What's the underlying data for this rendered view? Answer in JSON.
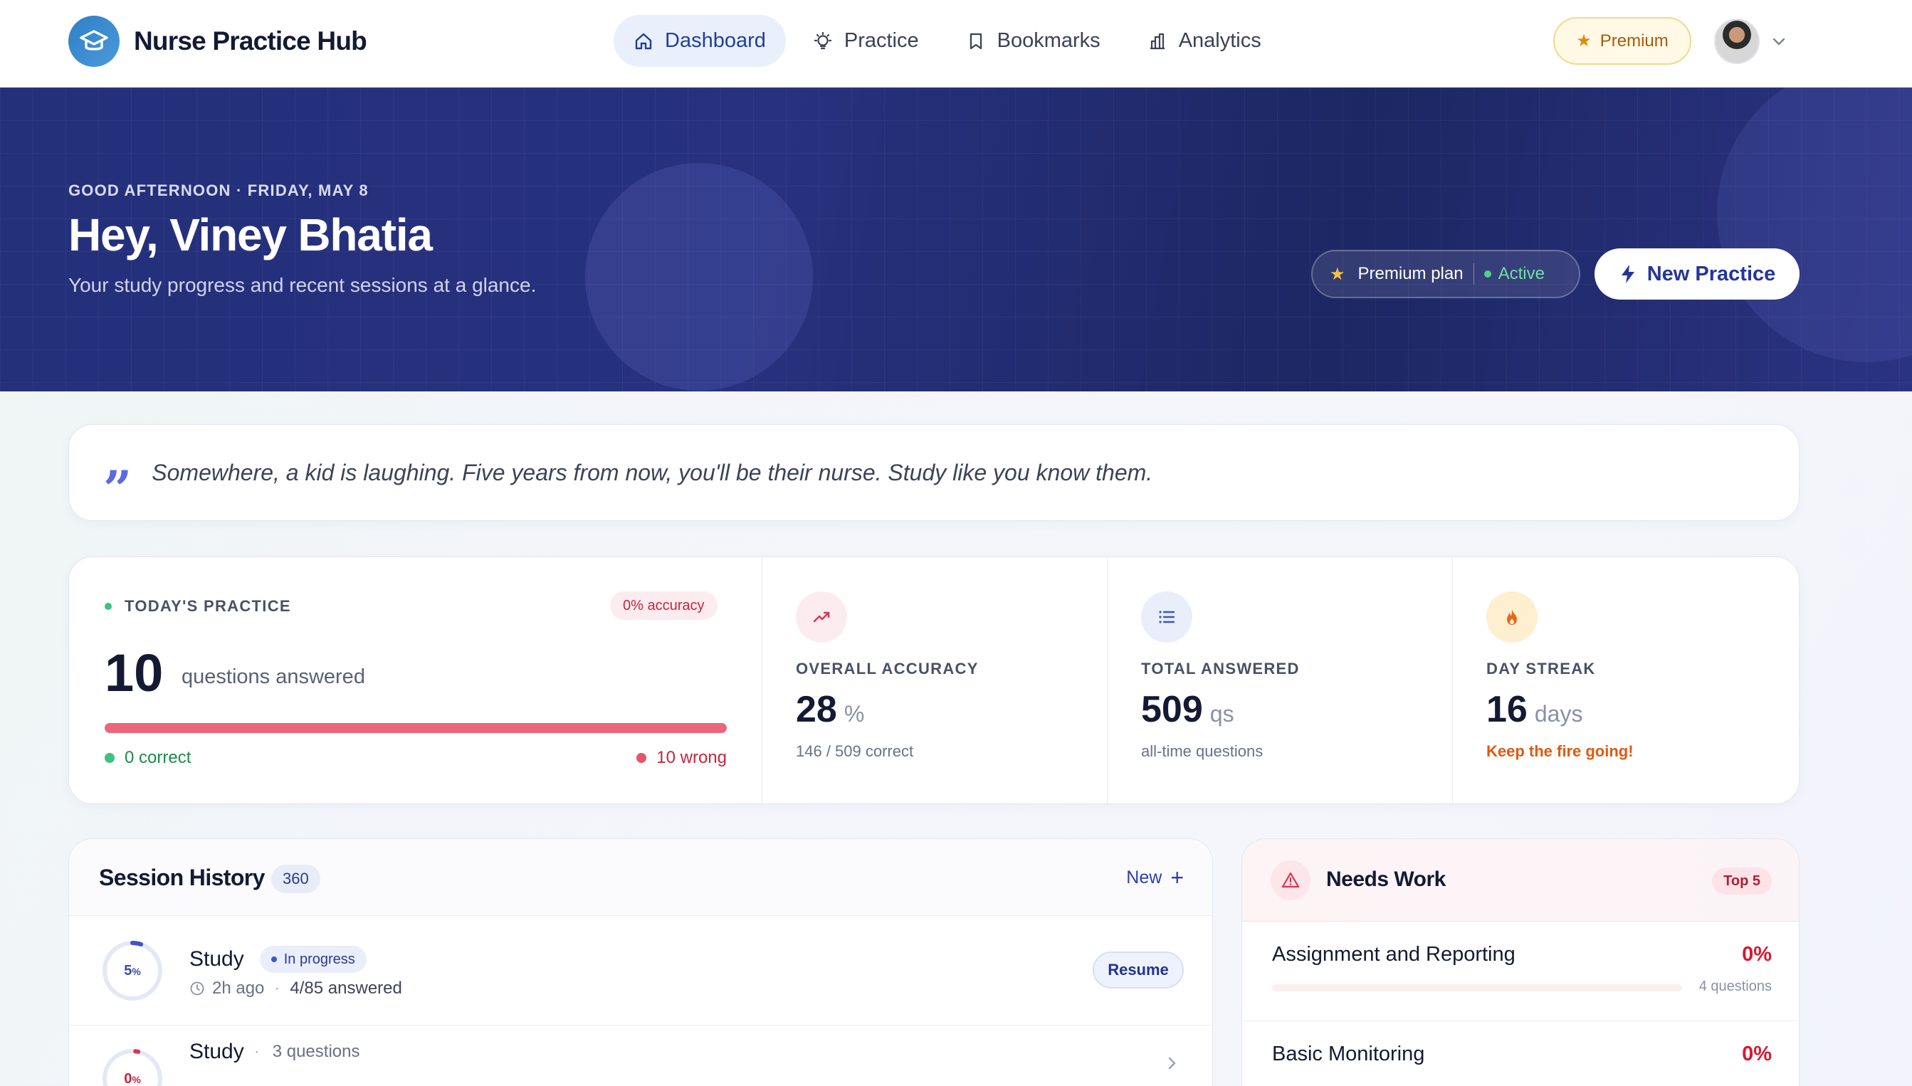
{
  "app": {
    "name": "Nurse Practice Hub"
  },
  "nav": {
    "items": [
      {
        "label": "Dashboard",
        "icon": "home-icon",
        "active": true
      },
      {
        "label": "Practice",
        "icon": "bulb-icon",
        "active": false
      },
      {
        "label": "Bookmarks",
        "icon": "bookmark-icon",
        "active": false
      },
      {
        "label": "Analytics",
        "icon": "bar-chart-icon",
        "active": false
      }
    ],
    "premium_label": "Premium"
  },
  "hero": {
    "greeting": "GOOD AFTERNOON · FRIDAY, MAY 8",
    "title": "Hey, Viney Bhatia",
    "subtitle": "Your study progress and recent sessions at a glance.",
    "plan_label": "Premium plan",
    "plan_status": "Active",
    "new_practice_label": "New Practice"
  },
  "quote": {
    "mark": "”",
    "text": "Somewhere, a kid is laughing. Five years from now, you'll be their nurse. Study like you know them."
  },
  "today": {
    "label": "TODAY'S PRACTICE",
    "accuracy_badge": "0% accuracy",
    "count": "10",
    "count_unit": "questions answered",
    "wrong_fraction": 1.0,
    "correct_label": "0 correct",
    "wrong_label": "10 wrong"
  },
  "metrics": {
    "accuracy": {
      "label": "OVERALL ACCURACY",
      "value": "28",
      "unit": "%",
      "sub": "146 / 509 correct",
      "icon": "trend-up-icon"
    },
    "total": {
      "label": "TOTAL ANSWERED",
      "value": "509",
      "unit": "qs",
      "sub": "all-time questions",
      "icon": "list-icon"
    },
    "streak": {
      "label": "DAY STREAK",
      "value": "16",
      "unit": "days",
      "sub": "Keep the fire going!",
      "icon": "flame-icon"
    }
  },
  "sessions": {
    "title": "Session History",
    "count": "360",
    "new_label": "New",
    "rows": [
      {
        "progress_text": "5",
        "progress_unit": "%",
        "progress": 0.05,
        "title": "Study",
        "badge": "In progress",
        "time": "2h ago",
        "answered": "4/85 answered",
        "action": "Resume"
      },
      {
        "progress_text": "0",
        "progress_unit": "%",
        "progress": 0.0,
        "title": "Study",
        "questions": "3 questions"
      }
    ]
  },
  "needs_work": {
    "title": "Needs Work",
    "badge": "Top 5",
    "rows": [
      {
        "name": "Assignment and Reporting",
        "pct": "0%",
        "questions": "4 questions",
        "fraction": 0.0
      },
      {
        "name": "Basic Monitoring",
        "pct": "0%",
        "questions": "",
        "fraction": 0.0
      }
    ]
  },
  "colors": {
    "primary": "#24359a",
    "hero_bg": "#24307a",
    "danger": "#d8182f",
    "success": "#3fc27c",
    "warning": "#e2590d"
  }
}
